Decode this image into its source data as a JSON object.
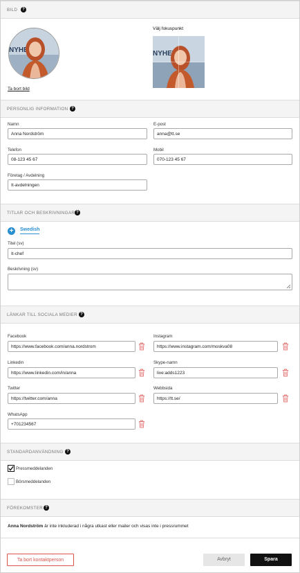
{
  "image_section": {
    "title": "BILD",
    "choose_focus_label": "Välj fokuspunkt",
    "remove_image_link": "Ta bort bild",
    "avatar_text": "NYHET"
  },
  "personal": {
    "title": "PERSONLIG INFORMATION",
    "name_label": "Namn",
    "name_value": "Anna Nordström",
    "email_label": "E-post",
    "email_value": "anna@tt.se",
    "phone_label": "Telefon",
    "phone_value": "08-123 45 67",
    "mobile_label": "Mobil",
    "mobile_value": "070-123 45 67",
    "company_label": "Företag / Avdelning",
    "company_value": "It-avdelningen"
  },
  "titles": {
    "title": "TITLAR OCH BESKRIVNINGAR",
    "language_tab": "Swedish",
    "title_label": "Titel (sv)",
    "title_value": "It-chef",
    "description_label": "Beskrivning (sv)",
    "description_value": ""
  },
  "social": {
    "title": "LÄNKAR TILL SOCIALA MEDIER",
    "facebook_label": "Facebook",
    "facebook_value": "https://www.facebook.com/anna.nordstrom",
    "instagram_label": "Instagram",
    "instagram_value": "https://www.instagram.com/moskva08",
    "linkedin_label": "Linkedin",
    "linkedin_value": "https://www.linkedin.com/in/anna",
    "skype_label": "Skype-namn",
    "skype_value": "live:adds1223",
    "twitter_label": "Twitter",
    "twitter_value": "https://twitter.com/anna",
    "website_label": "Webbsida",
    "website_value": "https://tt.se/",
    "whatsapp_label": "WhatsApp",
    "whatsapp_value": "+701234567"
  },
  "default_usage": {
    "title": "STANDARDANVÄNDNING",
    "press_release_label": "Pressmeddelanden",
    "press_release_checked": true,
    "news_label": "Börsmeddelanden",
    "news_checked": false
  },
  "occurrences": {
    "title": "FÖREKOMSTER",
    "name_bold": "Anna Nordström",
    "text": " är inte inkluderad i några utkast eller mailer och visas inte i pressrummet"
  },
  "footer": {
    "delete_button": "Ta bort kontaktperson",
    "cancel_button": "Avbryt",
    "save_button": "Spara"
  },
  "colors": {
    "accent": "#2a8fd0",
    "danger": "#d9534f",
    "save_bg": "#111111",
    "cancel_bg": "#e6e6e6"
  }
}
